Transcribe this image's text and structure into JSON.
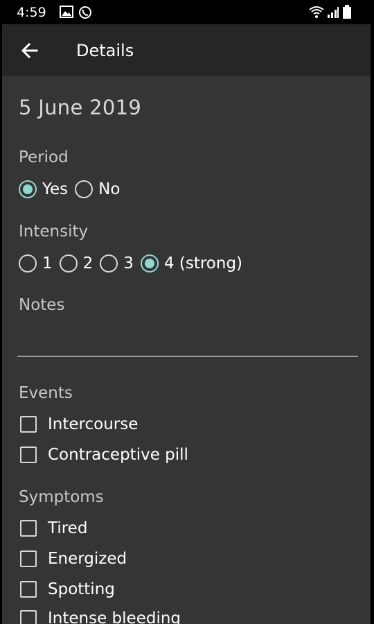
{
  "status_bar": {
    "time": "4:59",
    "icons": [
      "image-icon",
      "whatsapp-icon",
      "wifi-icon",
      "signal-icon",
      "battery-icon"
    ]
  },
  "app_bar": {
    "title": "Details",
    "back_icon": "arrow-left-icon"
  },
  "details": {
    "date": "5 June 2019",
    "period": {
      "label": "Period",
      "options": [
        {
          "label": "Yes",
          "selected": true
        },
        {
          "label": "No",
          "selected": false
        }
      ]
    },
    "intensity": {
      "label": "Intensity",
      "options": [
        {
          "label": "1",
          "selected": false
        },
        {
          "label": "2",
          "selected": false
        },
        {
          "label": "3",
          "selected": false
        },
        {
          "label": "4 (strong)",
          "selected": true
        }
      ]
    },
    "notes": {
      "label": "Notes",
      "value": ""
    },
    "events": {
      "label": "Events",
      "items": [
        {
          "label": "Intercourse",
          "checked": false
        },
        {
          "label": "Contraceptive pill",
          "checked": false
        }
      ]
    },
    "symptoms": {
      "label": "Symptoms",
      "items": [
        {
          "label": "Tired",
          "checked": false
        },
        {
          "label": "Energized",
          "checked": false
        },
        {
          "label": "Spotting",
          "checked": false
        },
        {
          "label": "Intense bleeding",
          "checked": false
        }
      ]
    }
  },
  "colors": {
    "app_bar": "#262626",
    "background": "#353535",
    "accent": "#8fd8d0"
  }
}
